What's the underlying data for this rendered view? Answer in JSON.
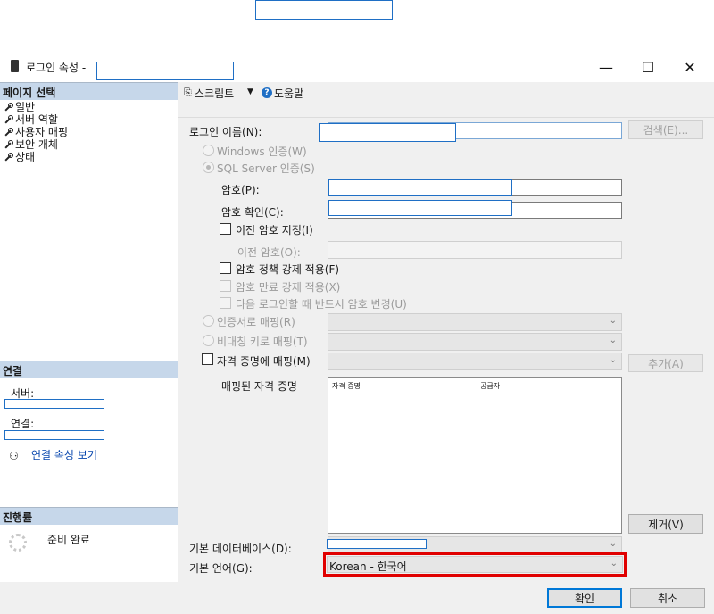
{
  "window": {
    "title": "로그인 속성 -",
    "minimize_glyph": "—",
    "maximize_glyph": "☐",
    "close_glyph": "✕"
  },
  "sidebar": {
    "section_title": "페이지 선택",
    "items": [
      {
        "label": "일반"
      },
      {
        "label": "서버 역할"
      },
      {
        "label": "사용자 매핑"
      },
      {
        "label": "보안 개체"
      },
      {
        "label": "상태"
      }
    ],
    "connection": {
      "title": "연결",
      "server_label": "서버:",
      "connection_label": "연결:",
      "view_link": "연결 속성 보기"
    },
    "progress": {
      "title": "진행률",
      "status": "준비 완료"
    }
  },
  "toolbar": {
    "script_label": "스크립트",
    "dropdown_glyph": "▼",
    "help_glyph": "?",
    "help_label": "도움말"
  },
  "form": {
    "login_name_label": "로그인 이름(N):",
    "search_button": "검색(E)...",
    "windows_auth": "Windows 인증(W)",
    "sql_auth": "SQL Server 인증(S)",
    "password_label": "암호(P):",
    "confirm_password_label": "암호 확인(C):",
    "specify_old_password": "이전 암호 지정(I)",
    "old_password_label": "이전 암호(O):",
    "enforce_policy": "암호 정책 강제 적용(F)",
    "enforce_expiration": "암호 만료 강제 적용(X)",
    "must_change": "다음 로그인할 때 반드시 암호 변경(U)",
    "cert_mapping": "인증서로 매핑(R)",
    "asym_key_mapping": "비대칭 키로 매핑(T)",
    "credential_mapping": "자격 증명에 매핑(M)",
    "add_button": "추가(A)",
    "mapped_credentials_label": "매핑된 자격 증명",
    "credentials_columns": [
      "자격 증명",
      "공급자"
    ],
    "remove_button": "제거(V)",
    "default_db_label": "기본 데이터베이스(D):",
    "default_language_label": "기본 언어(G):",
    "default_language_value": "Korean - 한국어"
  },
  "buttons": {
    "ok": "확인",
    "cancel": "취소"
  },
  "colors": {
    "highlight_border": "#e00000",
    "redaction_border": "#1f6fc5",
    "section_header": "#c6d7ea"
  }
}
